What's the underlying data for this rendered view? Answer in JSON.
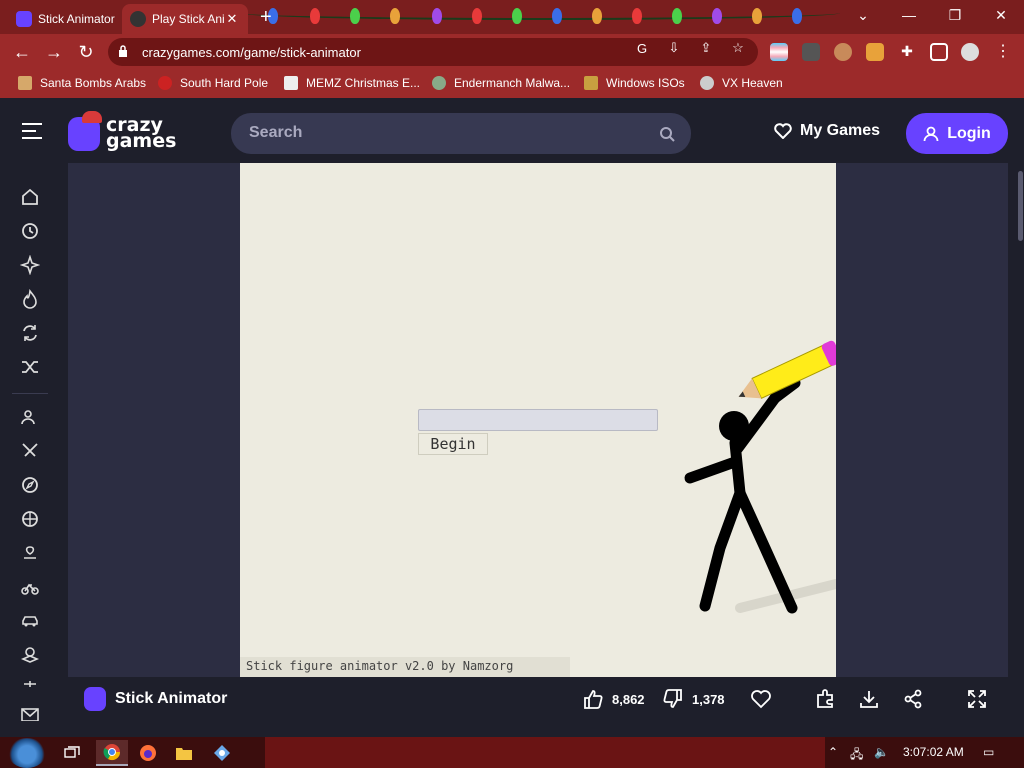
{
  "browser": {
    "tabs": [
      {
        "label": "Stick Animator",
        "active": true
      },
      {
        "label": "Play Stick Animator",
        "active": false
      }
    ],
    "url": "crazygames.com/game/stick-animator",
    "bookmarks": [
      "Santa Bombs Arabs",
      "South Hard Pole",
      "MEMZ Christmas E...",
      "Endermanch Malwa...",
      "Windows ISOs",
      "VX Heaven"
    ],
    "accent": "#9c2a2a"
  },
  "site": {
    "logo_line1": "crazy",
    "logo_line2": "games",
    "search_placeholder": "Search",
    "my_games": "My Games",
    "login": "Login",
    "brand_color": "#6842ff",
    "sidebar_icons": [
      "home-icon",
      "recent-icon",
      "new-icon",
      "trending-icon",
      "updated-icon",
      "random-icon",
      "multiplayer-icon",
      "action-icon",
      "adventure-icon",
      "sports-icon",
      "casual-icon",
      "bike-icon",
      "car-icon",
      "clicker-icon",
      "more-icon",
      "mail-icon"
    ]
  },
  "game": {
    "begin_label": "Begin",
    "credit": "Stick figure animator v2.0 by Namzorg",
    "title": "Stick Animator",
    "likes": "8,862",
    "dislikes": "1,378"
  },
  "taskbar": {
    "time": "3:07:02 AM",
    "apps": [
      "task-view",
      "chrome",
      "firefox",
      "file-explorer",
      "network-app"
    ]
  }
}
